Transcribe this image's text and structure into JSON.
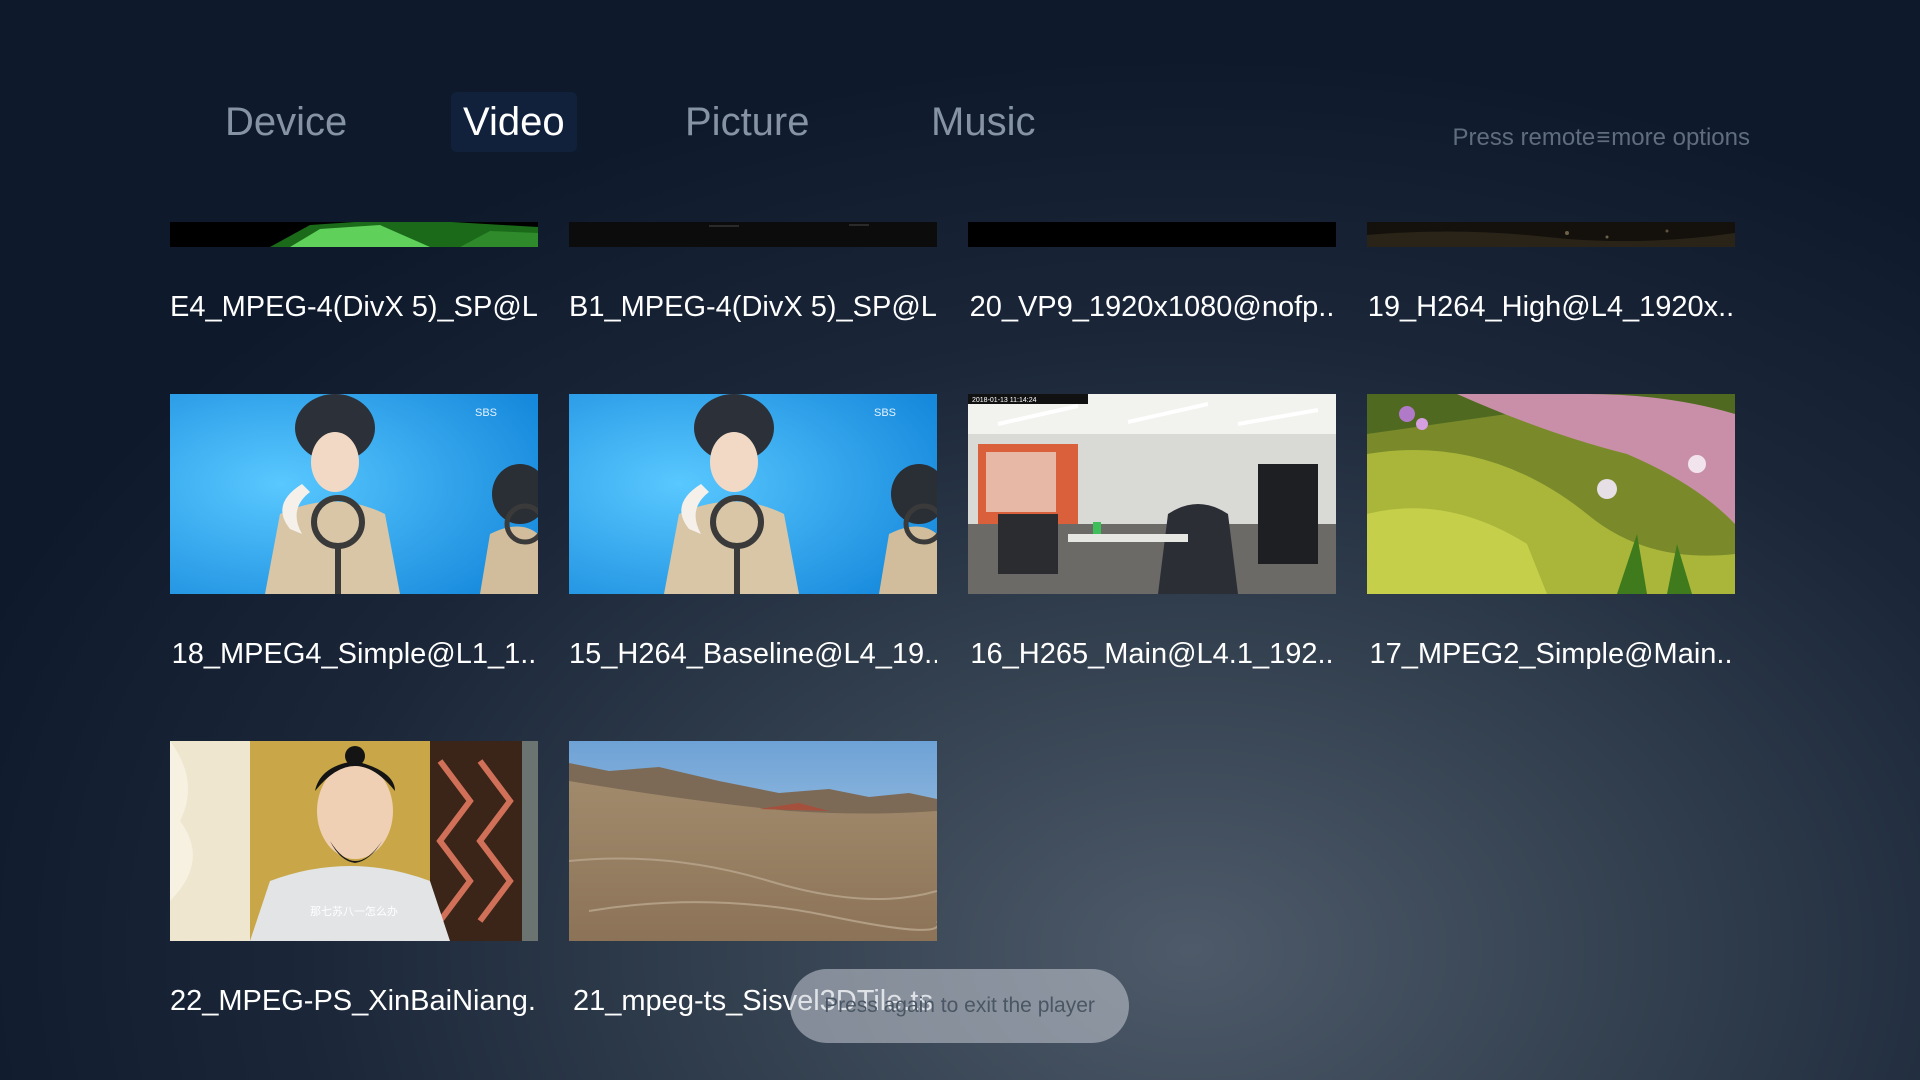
{
  "tabs": {
    "device": "Device",
    "video": "Video",
    "picture": "Picture",
    "music": "Music"
  },
  "hint": {
    "before": "Press remote",
    "icon": "≡",
    "after": "more options"
  },
  "videos": [
    {
      "title": "E4_MPEG-4(DivX 5)_SP@L..",
      "thumb": "green-abstract"
    },
    {
      "title": "B1_MPEG-4(DivX 5)_SP@L..",
      "thumb": "dark-frame"
    },
    {
      "title": "20_VP9_1920x1080@nofp..",
      "thumb": "black-frame"
    },
    {
      "title": "19_H264_High@L4_1920x..",
      "thumb": "dark-landscape"
    },
    {
      "title": "18_MPEG4_Simple@L1_1..",
      "thumb": "singer-performance"
    },
    {
      "title": "15_H264_Baseline@L4_19..",
      "thumb": "singer-performance"
    },
    {
      "title": "16_H265_Main@L4.1_192..",
      "thumb": "office-interior"
    },
    {
      "title": "17_MPEG2_Simple@Main..",
      "thumb": "animated-meadow"
    },
    {
      "title": "22_MPEG-PS_XinBaiNiang..",
      "thumb": "drama-scene"
    },
    {
      "title": "21_mpeg-ts_Sisvel3DTile.ts",
      "thumb": "desert-aerial"
    }
  ],
  "thumb_text": {
    "watermark": "SBS",
    "timestamp": "2018-01-13 11:14:24",
    "subtitle": "那七苏八一怎么办"
  },
  "toast": "Press again to exit the player",
  "colors": {
    "background_dark": "#0e1a2c",
    "background_light": "#4e5a69",
    "tab_inactive": "#8593a4",
    "tab_active": "#ffffff",
    "toast_bg": "#c4cbd3"
  }
}
